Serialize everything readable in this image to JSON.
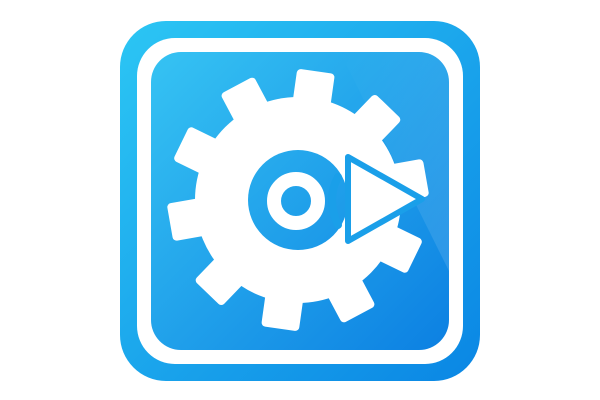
{
  "icon": {
    "name": "gear-arrow-app-icon",
    "colors": {
      "outer_top": "#2cc6f4",
      "outer_bottom": "#0a86e4",
      "inner_top": "#36c3f3",
      "inner_bottom": "#0c80e2",
      "frame": "#ffffff",
      "glyph": "#ffffff",
      "background": "#ffffff"
    }
  }
}
